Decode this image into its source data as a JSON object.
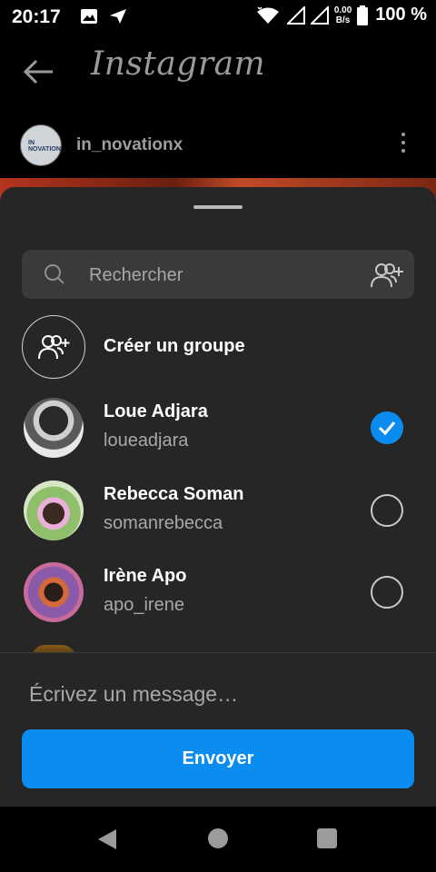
{
  "status_bar": {
    "time": "20:17",
    "speed_value": "0.00",
    "speed_unit": "B/s",
    "battery": "100 %"
  },
  "app": {
    "logo": "Instagram",
    "post_username": "in_novationx",
    "post_avatar_text": "IN NOVATION"
  },
  "share_sheet": {
    "search_placeholder": "Rechercher",
    "create_group_label": "Créer un groupe",
    "contacts": [
      {
        "name": "Loue Adjara",
        "username": "loueadjara",
        "selected": true
      },
      {
        "name": "Rebecca Soman",
        "username": "somanrebecca",
        "selected": false
      },
      {
        "name": "Irène Apo",
        "username": "apo_irene",
        "selected": false
      }
    ],
    "message_placeholder": "Écrivez un message…",
    "send_label": "Envoyer"
  },
  "colors": {
    "accent": "#0a8cf0",
    "sheet_background": "#262626",
    "search_background": "#3a3a3a"
  },
  "icons": [
    "back-arrow-icon",
    "search-icon",
    "add-people-icon",
    "group-add-icon",
    "check-icon",
    "more-options-icon",
    "wifi-icon",
    "signal-icon",
    "battery-icon",
    "gallery-icon",
    "send-icon"
  ]
}
